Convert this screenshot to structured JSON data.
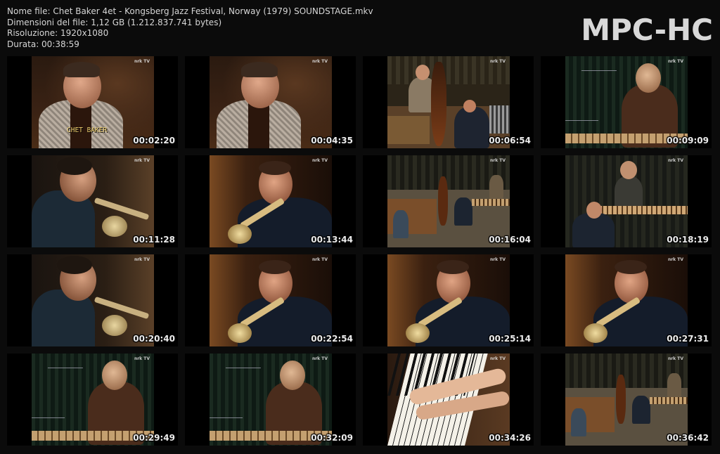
{
  "file_info": {
    "name": "Nome file: Chet Baker 4et - Kongsberg Jazz Festival, Norway (1979) SOUNDSTAGE.mkv",
    "size": "Dimensioni del file: 1,12 GB (1.212.837.741 bytes)",
    "resolution": "Risoluzione: 1920x1080",
    "duration": "Durata: 00:38:59"
  },
  "brand": "MPC-HC",
  "channel_logo": "nrk TV",
  "caption": "CHET BAKER",
  "thumbnails": [
    {
      "time": "00:02:20",
      "scene": "portrait"
    },
    {
      "time": "00:04:35",
      "scene": "portrait"
    },
    {
      "time": "00:06:54",
      "scene": "band"
    },
    {
      "time": "00:09:09",
      "scene": "vibes"
    },
    {
      "time": "00:11:28",
      "scene": "trumpet-side"
    },
    {
      "time": "00:13:44",
      "scene": "trumpet-close"
    },
    {
      "time": "00:16:04",
      "scene": "stage-wide"
    },
    {
      "time": "00:18:19",
      "scene": "stage-mid"
    },
    {
      "time": "00:20:40",
      "scene": "trumpet-side"
    },
    {
      "time": "00:22:54",
      "scene": "trumpet-close"
    },
    {
      "time": "00:25:14",
      "scene": "trumpet-close"
    },
    {
      "time": "00:27:31",
      "scene": "trumpet-close"
    },
    {
      "time": "00:29:49",
      "scene": "vibes"
    },
    {
      "time": "00:32:09",
      "scene": "vibes"
    },
    {
      "time": "00:34:26",
      "scene": "piano"
    },
    {
      "time": "00:36:42",
      "scene": "stage-wide"
    }
  ]
}
